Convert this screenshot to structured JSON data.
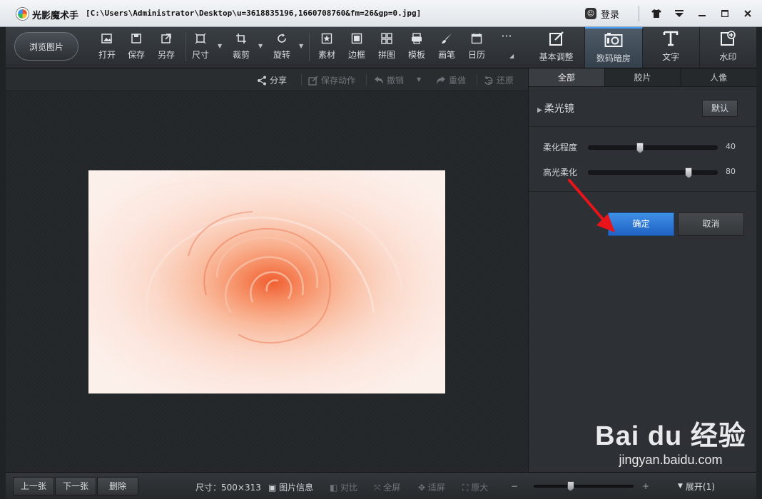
{
  "window": {
    "app_name": "光影魔术手",
    "file_path": "[C:\\Users\\Administrator\\Desktop\\u=3618835196,1660708760&fm=26&gp=0.jpg]",
    "login_label": "登录"
  },
  "toolbar": {
    "browse_label": "浏览图片",
    "tools": [
      {
        "label": "打开",
        "icon": "open-icon"
      },
      {
        "label": "保存",
        "icon": "save-icon"
      },
      {
        "label": "另存",
        "icon": "save-as-icon"
      },
      {
        "label": "尺寸",
        "icon": "resize-icon"
      },
      {
        "label": "裁剪",
        "icon": "crop-icon"
      },
      {
        "label": "旋转",
        "icon": "rotate-icon"
      },
      {
        "label": "素材",
        "icon": "material-icon"
      },
      {
        "label": "边框",
        "icon": "border-icon"
      },
      {
        "label": "拼图",
        "icon": "collage-icon"
      },
      {
        "label": "模板",
        "icon": "template-icon"
      },
      {
        "label": "画笔",
        "icon": "brush-icon"
      },
      {
        "label": "日历",
        "icon": "calendar-icon"
      }
    ],
    "more_icon": "more-icon"
  },
  "right_tabs": [
    {
      "label": "基本调整",
      "icon": "basic-adjust-icon",
      "active": false
    },
    {
      "label": "数码暗房",
      "icon": "darkroom-icon",
      "active": true
    },
    {
      "label": "文字",
      "icon": "text-icon",
      "active": false
    },
    {
      "label": "水印",
      "icon": "watermark-icon",
      "active": false
    }
  ],
  "actionbar": {
    "share": "分享",
    "save_action": "保存动作",
    "undo": "撤销",
    "redo": "重做",
    "restore": "还原"
  },
  "panel": {
    "subtabs": [
      "全部",
      "胶片",
      "人像"
    ],
    "effect_name": "柔光镜",
    "default_label": "默认",
    "sliders": [
      {
        "label": "柔化程度",
        "value": 40,
        "fraction": 0.4
      },
      {
        "label": "高光柔化",
        "value": 80,
        "fraction": 0.78
      }
    ],
    "ok_label": "确定",
    "cancel_label": "取消"
  },
  "bottombar": {
    "prev": "上一张",
    "next": "下一张",
    "delete": "删除",
    "size_text": "尺寸：500×313",
    "image_info": "图片信息",
    "compare": "对比",
    "fullscreen": "全屏",
    "fit": "适屏",
    "original": "原大",
    "expand": "展开(1)",
    "zoom_minus": "−",
    "zoom_plus": "+",
    "zoom_fraction": 0.33
  },
  "watermark": {
    "logo_text": "Bai du 经验",
    "url": "jingyan.baidu.com"
  },
  "colors": {
    "accent_blue": "#2f7be0",
    "annotation_red": "#e8141a"
  }
}
